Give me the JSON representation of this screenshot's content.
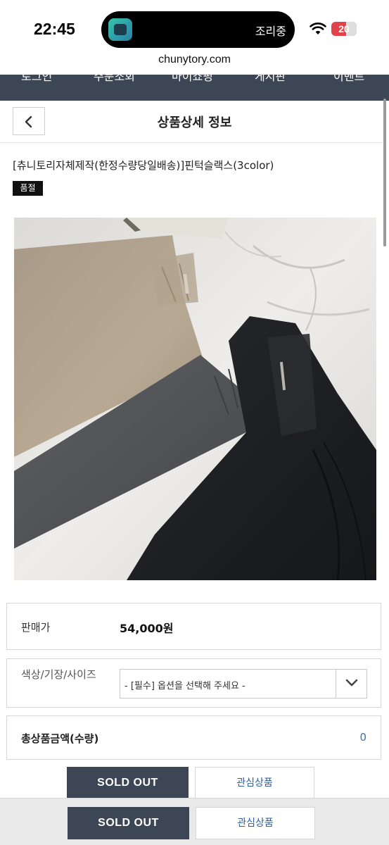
{
  "status_bar": {
    "time": "22:45",
    "island_text": "조리중",
    "battery": "20"
  },
  "browser": {
    "url": "chunytory.com"
  },
  "nav": {
    "items": [
      "로그인",
      "주문조회",
      "마이쇼핑",
      "게시판",
      "이벤트"
    ]
  },
  "header": {
    "title": "상품상세 정보"
  },
  "product": {
    "name": "[츄니토리자체제작(한정수량당일배송)]핀턱슬랙스(3color)",
    "badge": "품절",
    "image_icon": "product-photo-slacks"
  },
  "price": {
    "label": "판매가",
    "value": "54,000원"
  },
  "option": {
    "label": "색상/기장/사이즈",
    "placeholder": "- [필수] 옵션을 선택해 주세요 -"
  },
  "total": {
    "label": "총상품금액(수량)",
    "value": "0"
  },
  "actions": {
    "soldout_label": "SOLD OUT",
    "wish_label": "관심상품"
  },
  "colors": {
    "nav_bg": "#3d4655",
    "accent_blue": "#2f5f9e",
    "badge_bg": "#111111"
  }
}
